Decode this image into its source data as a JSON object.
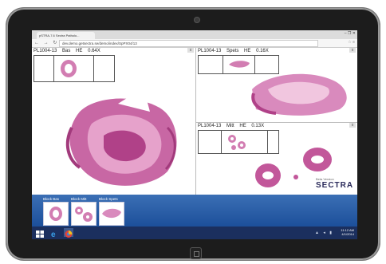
{
  "browser": {
    "tab_title": "pSTRA-7.6 Sectra Patholo...",
    "url": "dev.demo.getsectra.se/demo/index/SpPX04/13",
    "nav_glyphs": "← → ↻",
    "tools_glyphs": "☆ ≡",
    "window_controls": "– ❐ ✕"
  },
  "panes": {
    "left": {
      "case": "PL1004-13",
      "block": "Bas",
      "stain": "HE",
      "zoom": "0.64X"
    },
    "right_top": {
      "case": "PL1004-13",
      "block": "Spets",
      "stain": "HE",
      "zoom": "0.16X"
    },
    "right_bottom": {
      "case": "PL1004-13",
      "block": "Mitt",
      "stain": "HE",
      "zoom": "0.13X"
    }
  },
  "thumbnails": [
    {
      "label": "Block Bas"
    },
    {
      "label": "Block Mitt"
    },
    {
      "label": "Block Spets"
    }
  ],
  "brand": {
    "sub": "Beta Version",
    "name": "SECTRA"
  },
  "taskbar": {
    "systray": "▲ ◂ ▮",
    "clock_time": "11:12 AM",
    "clock_date": "4/1/2014"
  },
  "colors": {
    "tissue": "#c2579a",
    "tissue_light": "#e6a2cb",
    "taskbar": "#1b2f5e",
    "thumbbar": "#2a5fa8"
  },
  "icons": [
    "camera-icon",
    "home-button-icon",
    "windows-start-icon",
    "ie-icon",
    "chrome-icon"
  ]
}
